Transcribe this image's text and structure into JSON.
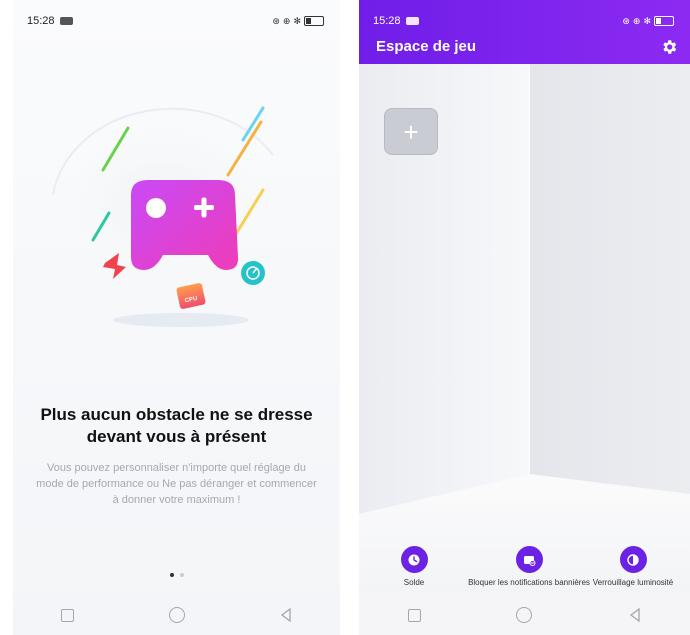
{
  "left": {
    "status": {
      "time": "15:28"
    },
    "headline": "Plus aucun obstacle ne se dresse devant vous à présent",
    "description": "Vous pouvez personnaliser n'importe quel réglage du mode de performance ou Ne pas déranger et commencer à donner votre maximum !",
    "hero_badge": "CPU",
    "pager": {
      "current": 1,
      "total": 2
    }
  },
  "right": {
    "status": {
      "time": "15:28"
    },
    "title": "Espace de jeu",
    "add_tile": "+",
    "tools": [
      {
        "label": "Solde",
        "icon": "clock-icon"
      },
      {
        "label": "Bloquer les notifications bannières",
        "icon": "notification-block-icon"
      },
      {
        "label": "Verrouillage luminosité",
        "icon": "brightness-lock-icon"
      }
    ]
  },
  "colors": {
    "accent": "#7626ec",
    "header_gradient_end": "#8c2af2"
  }
}
